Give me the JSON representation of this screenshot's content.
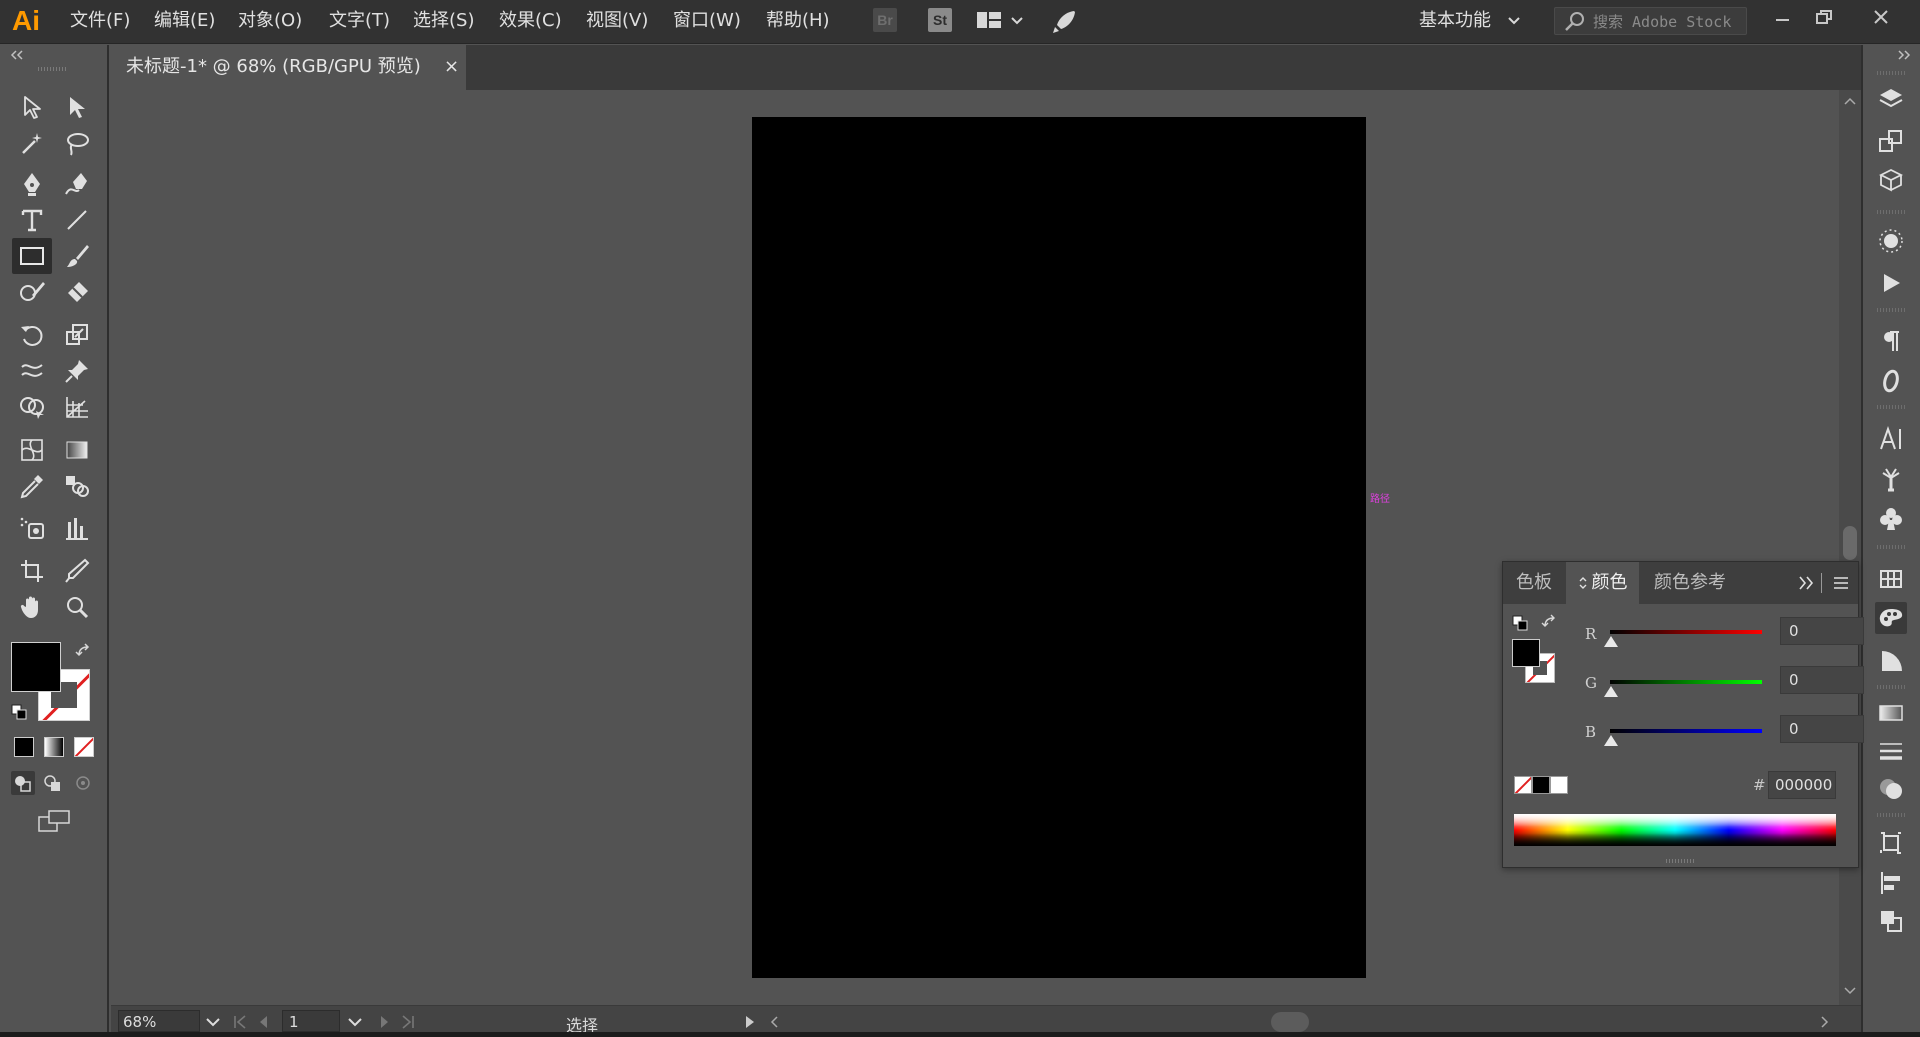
{
  "app": {
    "logo": "Ai"
  },
  "menu": {
    "file": "文件(F)",
    "edit": "编辑(E)",
    "object": "对象(O)",
    "type": "文字(T)",
    "select": "选择(S)",
    "effect": "效果(C)",
    "view": "视图(V)",
    "window": "窗口(W)",
    "help": "帮助(H)"
  },
  "toolbar": {
    "bridge_label": "Br",
    "stock_label": "St"
  },
  "workspace": {
    "label": "基本功能"
  },
  "search": {
    "placeholder": "搜索 Adobe Stock"
  },
  "document": {
    "tab_title": "未标题-1* @ 68% (RGB/GPU 预览)",
    "close": "×"
  },
  "canvas": {
    "smart_guide": "路径",
    "artboard_color": "#000000"
  },
  "status": {
    "zoom": "68%",
    "page": "1",
    "tool_status": "选择"
  },
  "color_panel": {
    "tabs": [
      "色板",
      "颜色",
      "颜色参考"
    ],
    "active_tab": "颜色",
    "channels": [
      {
        "label": "R",
        "value": "0"
      },
      {
        "label": "G",
        "value": "0"
      },
      {
        "label": "B",
        "value": "0"
      }
    ],
    "hex_label": "#",
    "hex_value": "000000"
  },
  "colors": {
    "fill": "#000000",
    "stroke": "none",
    "accent_app": "#ff9a00"
  }
}
